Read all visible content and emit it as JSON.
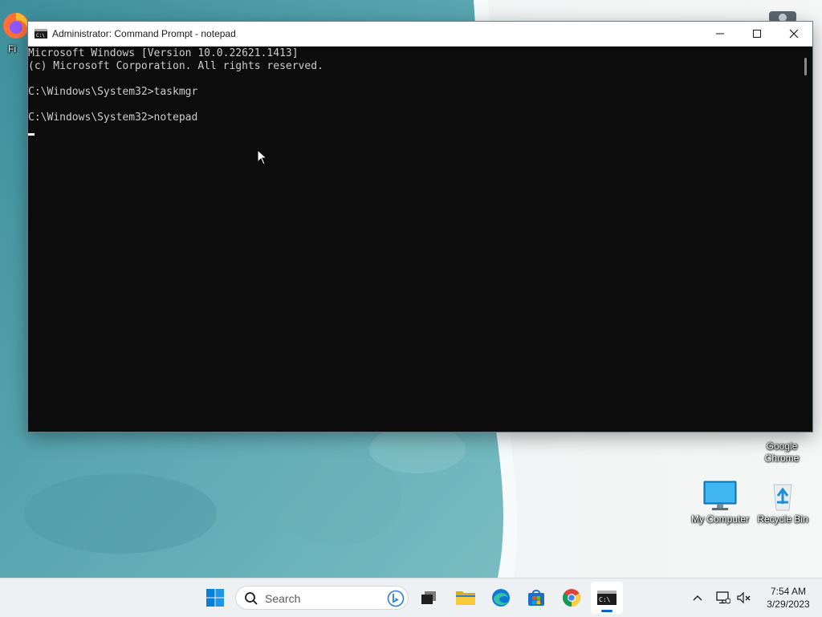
{
  "window": {
    "title": "Administrator:  Command Prompt - notepad",
    "controls": {
      "minimize_icon": "minimize-icon",
      "maximize_icon": "maximize-icon",
      "close_icon": "close-icon"
    }
  },
  "console": {
    "lines": [
      "Microsoft Windows [Version 10.0.22621.1413]",
      "(c) Microsoft Corporation. All rights reserved.",
      "",
      "C:\\Windows\\System32>taskmgr",
      "",
      "C:\\Windows\\System32>notepad"
    ],
    "foreground": "#cccccc",
    "background": "#0c0c0c"
  },
  "desktop": {
    "icons": [
      {
        "label": "Fi",
        "icon": "firefox-icon"
      },
      {
        "label": "Google Chrome",
        "icon": "chrome-icon"
      },
      {
        "label": "My Computer",
        "icon": "monitor-icon"
      },
      {
        "label": "Recycle Bin",
        "icon": "recycle-bin-icon"
      }
    ]
  },
  "taskbar": {
    "search_placeholder": "Search",
    "apps": [
      {
        "name": "start",
        "icon": "windows-start-icon"
      },
      {
        "name": "task-view",
        "icon": "task-view-icon"
      },
      {
        "name": "file-explorer",
        "icon": "folder-icon"
      },
      {
        "name": "edge",
        "icon": "edge-icon"
      },
      {
        "name": "store",
        "icon": "store-icon"
      },
      {
        "name": "chrome",
        "icon": "chrome-icon"
      },
      {
        "name": "command-prompt",
        "icon": "terminal-icon",
        "active": true
      }
    ],
    "tray": {
      "overflow_icon": "chevron-up-icon",
      "network_icon": "network-icon",
      "volume_icon": "volume-muted-icon"
    },
    "clock": {
      "time": "7:54 AM",
      "date": "3/29/2023"
    },
    "accent": "#0067c0"
  }
}
